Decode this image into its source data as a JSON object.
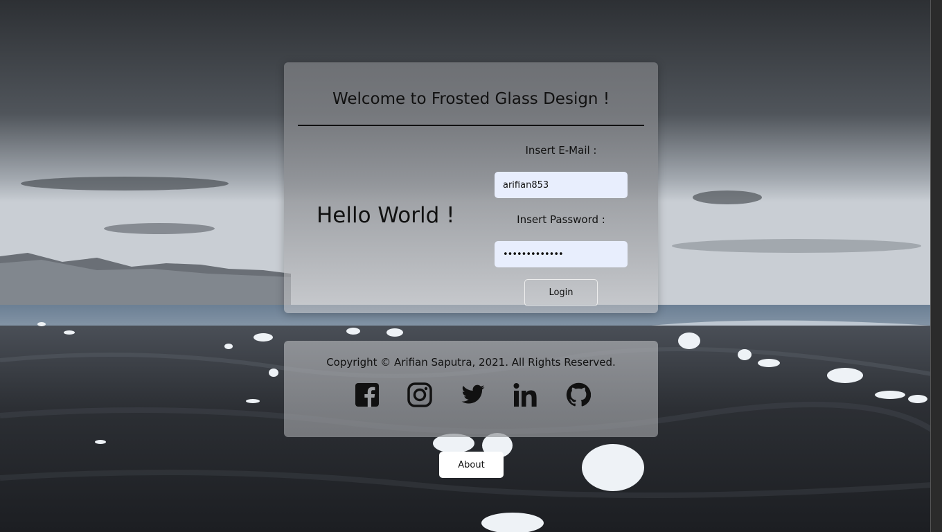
{
  "card": {
    "title": "Welcome to Frosted Glass Design !",
    "hello": "Hello World !",
    "email_label": "Insert E-Mail :",
    "email_value": "arifian853",
    "password_label": "Insert Password :",
    "password_value": "•••••••••••••",
    "login_label": "Login"
  },
  "footer": {
    "copyright": "Copyright © Arifian Saputra, 2021. All Rights Reserved.",
    "social": [
      "facebook-icon",
      "instagram-icon",
      "twitter-icon",
      "linkedin-icon",
      "github-icon"
    ]
  },
  "about_label": "About",
  "colors": {
    "input_bg": "#e8eefd",
    "text": "#111111",
    "button_bg": "#ffffff"
  }
}
